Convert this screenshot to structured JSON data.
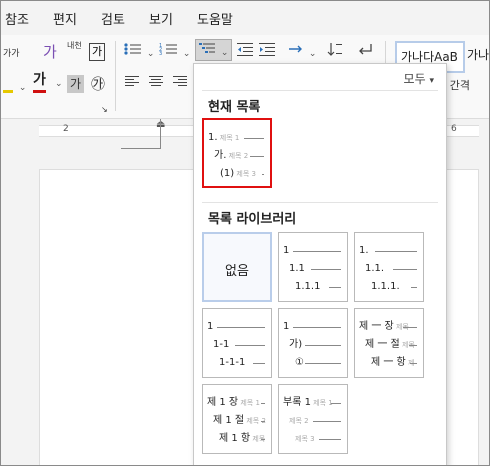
{
  "menu": [
    "참조",
    "편지",
    "검토",
    "보기",
    "도움말"
  ],
  "ribbon": {
    "font_grow": "가가",
    "ga_phonetic": "가",
    "ga_box": "가",
    "ga_color": "가",
    "ga_shade": "가",
    "circle_char": "㉮",
    "char_label": "내천",
    "style_normal": "가나다AaB",
    "style_next": "가나다",
    "style_sub": "↵ 간격"
  },
  "ruler": {
    "left_num": "2",
    "right_num": "6"
  },
  "panel": {
    "filter": "모두",
    "current_title": "현재 목록",
    "library_title": "목록 라이브러리",
    "current_tile": {
      "rows": [
        {
          "label": "1.",
          "sub": "제목 1"
        },
        {
          "label": "가.",
          "sub": "제목 2"
        },
        {
          "label": "(1)",
          "sub": "제목 3"
        }
      ]
    },
    "none_label": "없음",
    "tiles": [
      {
        "rows": [
          {
            "label": "1",
            "sub": ""
          },
          {
            "label": "1.1",
            "sub": ""
          },
          {
            "label": "1.1.1",
            "sub": ""
          }
        ]
      },
      {
        "rows": [
          {
            "label": "1.",
            "sub": ""
          },
          {
            "label": "1.1.",
            "sub": ""
          },
          {
            "label": "1.1.1.",
            "sub": ""
          }
        ]
      },
      {
        "rows": [
          {
            "label": "1",
            "sub": ""
          },
          {
            "label": "1-1",
            "sub": ""
          },
          {
            "label": "1-1-1",
            "sub": ""
          }
        ]
      },
      {
        "rows": [
          {
            "label": "1",
            "sub": ""
          },
          {
            "label": "가)",
            "sub": ""
          },
          {
            "label": "①",
            "sub": ""
          }
        ]
      },
      {
        "rows": [
          {
            "label": "제 一 장",
            "sub": "제목"
          },
          {
            "label": "제 一 절",
            "sub": "제목"
          },
          {
            "label": "제 一 항",
            "sub": "제"
          }
        ]
      },
      {
        "rows": [
          {
            "label": "제 1 장",
            "sub": "제목 1"
          },
          {
            "label": "제 1 절",
            "sub": "제목 2"
          },
          {
            "label": "제 1 항",
            "sub": "제목"
          }
        ]
      },
      {
        "rows": [
          {
            "label": "부록 1",
            "sub": "제목 1"
          },
          {
            "label": "",
            "sub": "제목 2"
          },
          {
            "label": "",
            "sub": "제목 3"
          }
        ]
      }
    ]
  },
  "colors": {
    "highlight": "#e6c800",
    "font_color": "#d01010",
    "selection": "#e01010"
  }
}
